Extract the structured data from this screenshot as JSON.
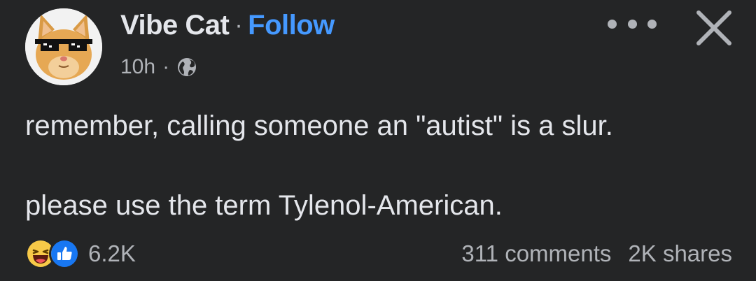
{
  "post": {
    "author": "Vibe Cat",
    "separator": "·",
    "follow_label": "Follow",
    "time": "10h",
    "privacy_icon": "globe-icon",
    "text_line1": "remember, calling someone an \"autist\" is a slur.",
    "text_line2": "please use the term Tylenol-American.",
    "reactions": {
      "icons": [
        "haha-icon",
        "like-icon"
      ],
      "count": "6.2K"
    },
    "comments": "311 comments",
    "shares": "2K shares"
  },
  "colors": {
    "background": "#242526",
    "text": "#e4e6eb",
    "secondary_text": "#b0b3b8",
    "follow": "#4599ff",
    "like_blue": "#1877f2",
    "haha_yellow": "#f7c948"
  }
}
